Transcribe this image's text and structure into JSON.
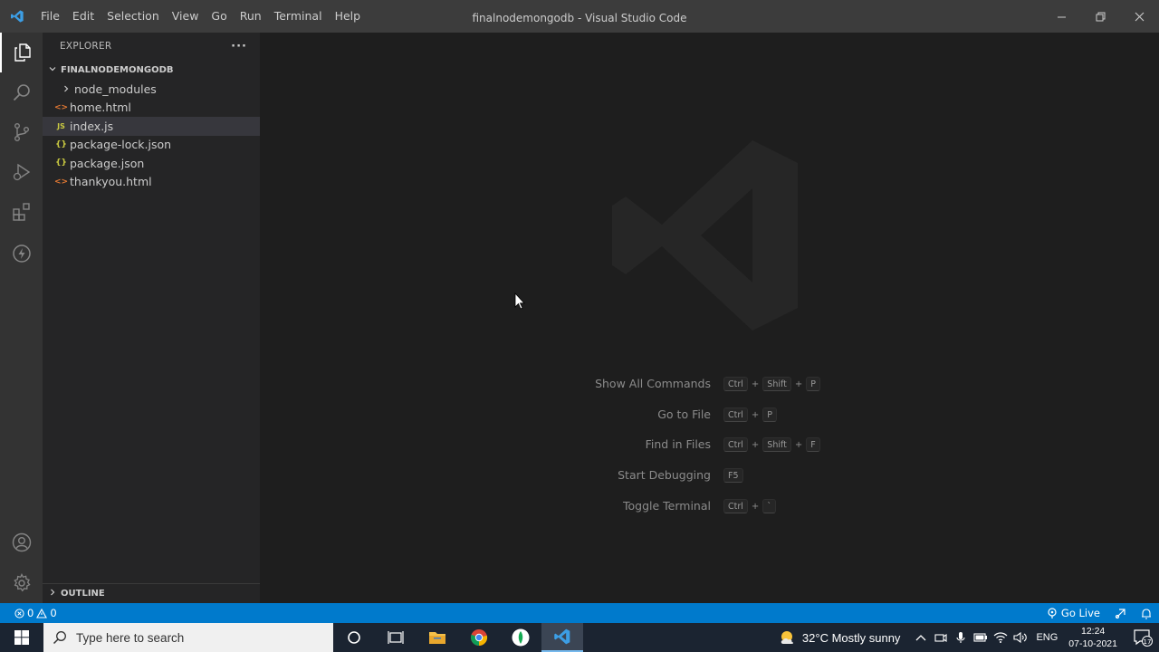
{
  "window": {
    "title": "finalnodemongodb - Visual Studio Code",
    "menu": [
      "File",
      "Edit",
      "Selection",
      "View",
      "Go",
      "Run",
      "Terminal",
      "Help"
    ]
  },
  "sidebar": {
    "header": "EXPLORER",
    "more_label": "···",
    "folder_name": "FINALNODEMONGODB",
    "files": [
      {
        "name": "node_modules",
        "icon": "folder-chevron-icon",
        "badge": ">"
      },
      {
        "name": "home.html",
        "icon": "html-file-icon",
        "badge": "<>"
      },
      {
        "name": "index.js",
        "icon": "js-file-icon",
        "badge": "JS"
      },
      {
        "name": "package-lock.json",
        "icon": "json-file-icon",
        "badge": "{}"
      },
      {
        "name": "package.json",
        "icon": "json-file-icon",
        "badge": "{}"
      },
      {
        "name": "thankyou.html",
        "icon": "html-file-icon",
        "badge": "<>"
      }
    ],
    "selected_file": "index.js",
    "outline_label": "OUTLINE"
  },
  "editor": {
    "shortcuts": [
      {
        "label": "Show All Commands",
        "keys": [
          "Ctrl",
          "Shift",
          "P"
        ]
      },
      {
        "label": "Go to File",
        "keys": [
          "Ctrl",
          "P"
        ]
      },
      {
        "label": "Find in Files",
        "keys": [
          "Ctrl",
          "Shift",
          "F"
        ]
      },
      {
        "label": "Start Debugging",
        "keys": [
          "F5"
        ]
      },
      {
        "label": "Toggle Terminal",
        "keys": [
          "Ctrl",
          "`"
        ]
      }
    ]
  },
  "statusbar": {
    "errors": "0",
    "warnings": "0",
    "go_live": "Go Live"
  },
  "taskbar": {
    "search_placeholder": "Type here to search",
    "weather": "32°C  Mostly sunny",
    "language": "ENG",
    "time": "12:24",
    "date": "07-10-2021",
    "notification_count": "17"
  },
  "colors": {
    "accent": "#007acc",
    "titlebar": "#3c3c3c",
    "sidebar": "#252526",
    "editor": "#1e1e1e",
    "activitybar": "#333333"
  }
}
